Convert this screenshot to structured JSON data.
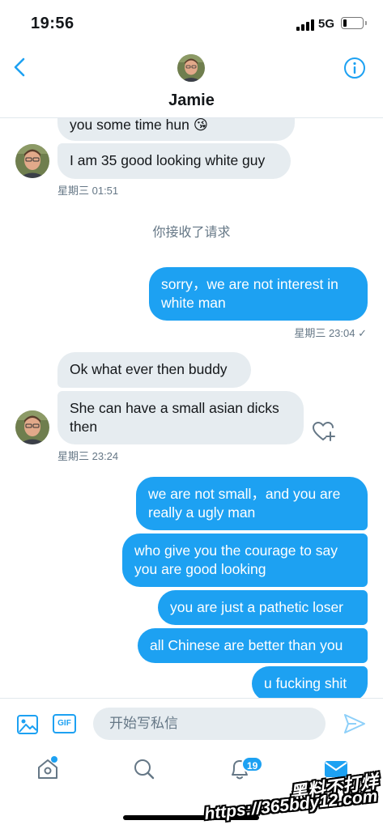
{
  "status_bar": {
    "time": "19:56",
    "network": "5G",
    "battery_level": 0.2
  },
  "header": {
    "name": "Jamie",
    "back_icon": "chevron-left-icon",
    "info_icon": "info-icon"
  },
  "messages": [
    {
      "id": "m1",
      "direction": "in",
      "text": "you some time hun 😘"
    },
    {
      "id": "m2",
      "direction": "in",
      "text": "I am 35 good looking white guy"
    },
    {
      "id": "t1",
      "type": "timestamp",
      "text": "星期三 01:51"
    },
    {
      "id": "s1",
      "type": "system",
      "text": "你接收了请求"
    },
    {
      "id": "m3",
      "direction": "out",
      "lines": [
        "sorry，we are not interest in",
        "white man"
      ]
    },
    {
      "id": "t2",
      "type": "timestamp",
      "text": "星期三 23:04 ✓"
    },
    {
      "id": "m4",
      "direction": "in",
      "text": "Ok what ever then buddy"
    },
    {
      "id": "m5",
      "direction": "in",
      "lines": [
        "She can have a small asian dicks",
        "then"
      ]
    },
    {
      "id": "t3",
      "type": "timestamp",
      "text": "星期三 23:24"
    },
    {
      "id": "m6",
      "direction": "out",
      "lines": [
        "we are not small，and you are",
        "really a ugly man"
      ]
    },
    {
      "id": "m7",
      "direction": "out",
      "lines": [
        "who give you the courage to say",
        "you are good looking"
      ]
    },
    {
      "id": "m8",
      "direction": "out",
      "text": "you are just a pathetic loser"
    },
    {
      "id": "m9",
      "direction": "out",
      "text": "all Chinese are better than you"
    },
    {
      "id": "m10",
      "direction": "out",
      "text": "u fucking shit"
    }
  ],
  "composer": {
    "placeholder": "开始写私信",
    "gif_label": "GIF"
  },
  "tabbar": {
    "notification_count": "19",
    "tabs": [
      "home-icon",
      "search-icon",
      "notifications-bell-icon",
      "messages-envelope-icon"
    ]
  },
  "watermark": {
    "line1": "黑料不打烊",
    "line2": "https://365bdy12.com"
  },
  "colors": {
    "accent": "#1da1f2",
    "incoming_bubble": "#e6ecf0",
    "meta_text": "#657786"
  }
}
